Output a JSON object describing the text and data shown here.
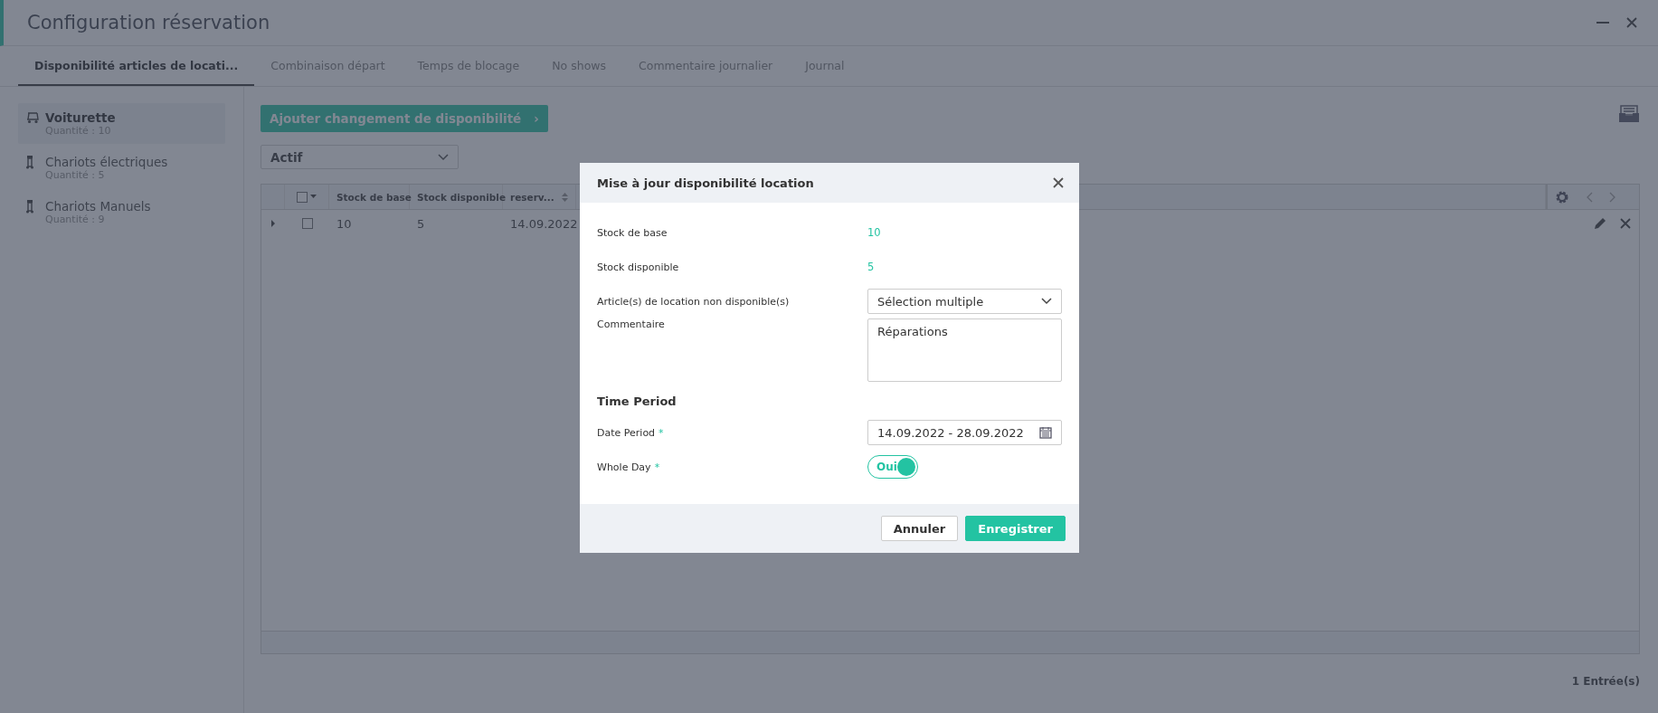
{
  "window": {
    "title": "Configuration réservation"
  },
  "tabs": [
    {
      "label": "Disponibilité articles de locati...",
      "selected": true
    },
    {
      "label": "Combinaison départ",
      "selected": false
    },
    {
      "label": "Temps de blocage",
      "selected": false
    },
    {
      "label": "No shows",
      "selected": false
    },
    {
      "label": "Commentaire journalier",
      "selected": false
    },
    {
      "label": "Journal",
      "selected": false
    }
  ],
  "sidebar": {
    "items": [
      {
        "name": "Voiturette",
        "quantity": "Quantité : 10",
        "selected": true,
        "kind": "cart"
      },
      {
        "name": "Chariots électriques",
        "quantity": "Quantité : 5",
        "selected": false,
        "kind": "trolley"
      },
      {
        "name": "Chariots Manuels",
        "quantity": "Quantité : 9",
        "selected": false,
        "kind": "trolley"
      }
    ]
  },
  "add_button": {
    "label": "Ajouter changement de disponibilité",
    "chevron": "›"
  },
  "filter": {
    "value": "Actif"
  },
  "table": {
    "select_all_checked": false,
    "columns": [
      "Stock de base",
      "Stock disponible",
      "reserv..."
    ],
    "rows": [
      {
        "cells": [
          "10",
          "5",
          "14.09.2022"
        ],
        "checked": false,
        "expanded": false
      }
    ]
  },
  "entries": "1 Entrée(s)",
  "modal": {
    "title": "Mise à jour disponibilité location",
    "fields": [
      {
        "kind": "value",
        "label": "Stock de base",
        "value": "10"
      },
      {
        "kind": "value",
        "label": "Stock disponible",
        "value": "5"
      },
      {
        "kind": "select",
        "label": "Article(s) de location non disponible(s)",
        "value": "Sélection multiple"
      },
      {
        "kind": "textarea",
        "label": "Commentaire",
        "value": "Réparations"
      }
    ],
    "section": "Time Period",
    "period_fields": [
      {
        "kind": "date",
        "label": "Date Period",
        "required_mark": "*",
        "value": "14.09.2022 - 28.09.2022"
      },
      {
        "kind": "toggle",
        "label": "Whole Day",
        "required_mark": "*",
        "on": true,
        "value": "Oui"
      }
    ],
    "buttons": [
      {
        "label": "Annuler",
        "kind": "secondary"
      },
      {
        "label": "Enregistrer",
        "kind": "primary"
      }
    ]
  }
}
